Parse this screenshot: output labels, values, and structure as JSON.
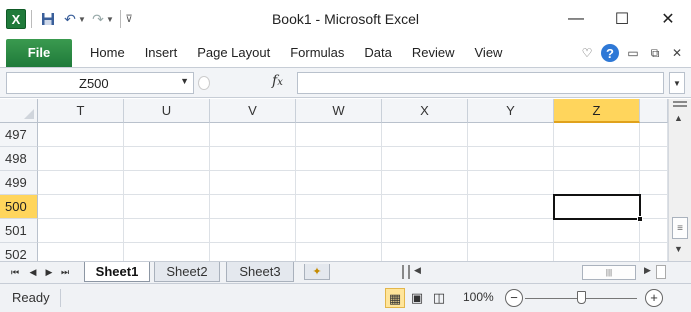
{
  "window": {
    "title": "Book1 - Microsoft Excel",
    "app_icon": "excel-icon",
    "minimize": "—",
    "maximize": "☐",
    "close": "✕"
  },
  "quick_access": {
    "items": [
      "save-icon",
      "undo-icon",
      "redo-icon",
      "customize-qat-icon"
    ]
  },
  "ribbon": {
    "file_tab": "File",
    "tabs": [
      "Home",
      "Insert",
      "Page Layout",
      "Formulas",
      "Data",
      "Review",
      "View"
    ],
    "help": "?"
  },
  "formula_bar": {
    "name_box": "Z500",
    "fx": "fx",
    "formula": ""
  },
  "grid": {
    "columns": [
      "T",
      "U",
      "V",
      "W",
      "X",
      "Y",
      "Z"
    ],
    "active_column": "Z",
    "rows": [
      "497",
      "498",
      "499",
      "500",
      "501",
      "502"
    ],
    "active_row": "500",
    "active_cell": "Z500"
  },
  "sheets": {
    "tabs": [
      "Sheet1",
      "Sheet2",
      "Sheet3"
    ],
    "active": "Sheet1"
  },
  "status_bar": {
    "mode": "Ready",
    "zoom": "100%",
    "zoom_minus": "−",
    "zoom_plus": "+"
  },
  "colors": {
    "file_tab": "#1f7a3a",
    "active_header": "#ffd55c",
    "help_icon": "#2e78d6"
  }
}
